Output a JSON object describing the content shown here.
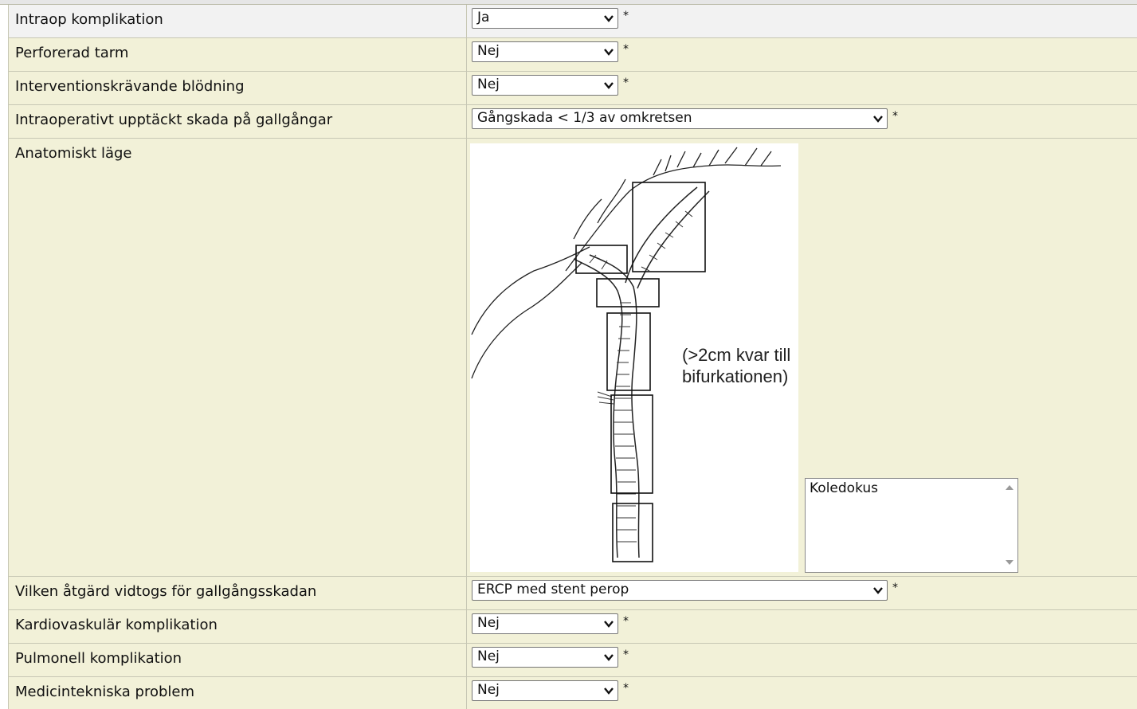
{
  "rows": {
    "intraop": {
      "label": "Intraop komplikation",
      "value": "Ja"
    },
    "tarm": {
      "label": "Perforerad tarm",
      "value": "Nej"
    },
    "blodning": {
      "label": "Interventionskrävande blödning",
      "value": "Nej"
    },
    "gallgangar": {
      "label": "Intraoperativt upptäckt skada på gallgångar",
      "value": "Gångskada < 1/3 av omkretsen"
    },
    "anatomiskt": {
      "label": "Anatomiskt läge",
      "image_note_line1": "(>2cm kvar till",
      "image_note_line2": "bifurkationen)",
      "listbox_value": "Koledokus"
    },
    "atgard": {
      "label": "Vilken åtgärd vidtogs för gallgångsskadan",
      "value": "ERCP med stent perop"
    },
    "kardio": {
      "label": "Kardiovaskulär komplikation",
      "value": "Nej"
    },
    "pulm": {
      "label": "Pulmonell komplikation",
      "value": "Nej"
    },
    "medtek": {
      "label": "Medicintekniska problem",
      "value": "Nej"
    }
  },
  "required_marker": "*",
  "colors": {
    "row_bg": "#f2f1d8",
    "first_row_bg": "#f2f2f2",
    "border": "#c7c7b4"
  },
  "icons": {
    "dropdown": "chevron-down-icon",
    "scroll_up": "scroll-up-arrow-icon",
    "scroll_down": "scroll-down-arrow-icon"
  }
}
